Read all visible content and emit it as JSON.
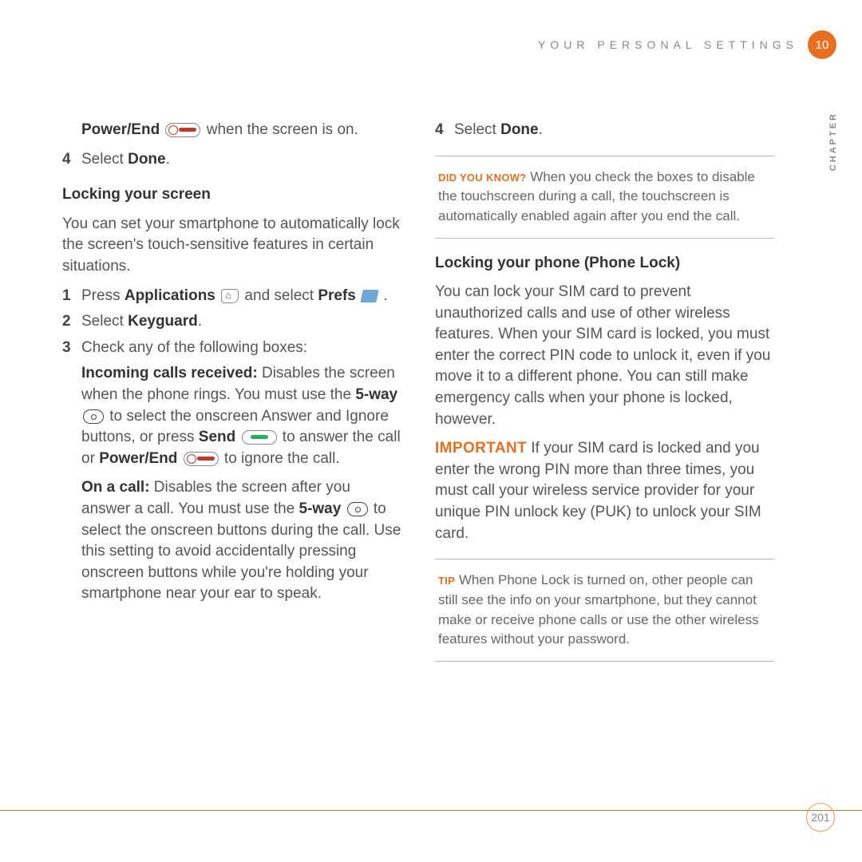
{
  "header": {
    "title": "YOUR PERSONAL SETTINGS",
    "chapter_num": "10",
    "chapter_side": "CHAPTER"
  },
  "left": {
    "intro_bold": "Power/End",
    "intro_rest": " when the screen is on.",
    "step4_num": "4",
    "step4_prefix": "Select ",
    "step4_bold": "Done",
    "step4_suffix": ".",
    "h_lockscreen": "Locking your screen",
    "lockscreen_para": "You can set your smartphone to automatically lock the screen's touch-sensitive features in certain situations.",
    "s1_num": "1",
    "s1_a": "Press ",
    "s1_b": "Applications",
    "s1_c": " and select ",
    "s1_d": "Prefs",
    "s1_e": " .",
    "s2_num": "2",
    "s2_a": "Select ",
    "s2_b": "Keyguard",
    "s2_c": ".",
    "s3_num": "3",
    "s3_a": "Check any of the following boxes:",
    "inc_label": "Incoming calls received:",
    "inc_a": " Disables the screen when the phone rings. You must use the ",
    "inc_b": "5-way",
    "inc_c": " to select the onscreen Answer and Ignore buttons, or press ",
    "inc_d": "Send",
    "inc_e": " to answer the call or ",
    "inc_f": "Power/End",
    "inc_g": " to ignore the call.",
    "oncall_label": "On a call:",
    "oncall_a": " Disables the screen after you answer a call. You must use the ",
    "oncall_b": "5-way",
    "oncall_c": " to select the onscreen buttons during the call. Use this setting to avoid accidentally pressing onscreen buttons while you're holding your smartphone near your ear to speak."
  },
  "right": {
    "step4_num": "4",
    "step4_prefix": "Select ",
    "step4_bold": "Done",
    "step4_suffix": ".",
    "didyouknow_label": "DID YOU KNOW?",
    "didyouknow_text": " When you check the boxes to disable the touchscreen during a call, the touchscreen is automatically enabled again after you end the call.",
    "h_phonelock": "Locking your phone (Phone Lock)",
    "phonelock_para": "You can lock your SIM card to prevent unauthorized calls and use of other wireless features. When your SIM card is locked, you must enter the correct PIN code to unlock it, even if you move it to a different phone. You can still make emergency calls when your phone is locked, however.",
    "important_label": "IMPORTANT",
    "important_text": " If your SIM card is locked and you enter the wrong PIN more than three times, you must call your wireless service provider for your unique PIN unlock key (PUK) to unlock your SIM card.",
    "tip_label": "TIP",
    "tip_text": " When Phone Lock is turned on, other people can still see the info on your smartphone, but they cannot make or receive phone calls or use the other wireless features without your password."
  },
  "footer": {
    "page": "201"
  }
}
